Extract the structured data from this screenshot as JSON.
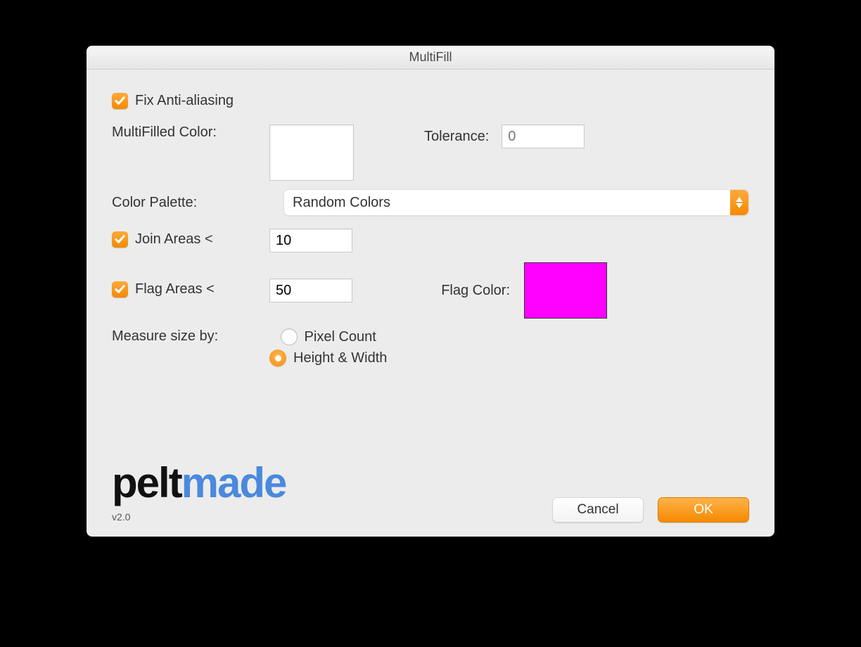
{
  "window": {
    "title": "MultiFill"
  },
  "fixAA": {
    "checked": true,
    "label": "Fix Anti-aliasing"
  },
  "multifilled": {
    "label": "MultiFilled Color:",
    "color": "#ffffff"
  },
  "tolerance": {
    "label": "Tolerance:",
    "value": "",
    "placeholder": "0"
  },
  "palette": {
    "label": "Color Palette:",
    "selected": "Random Colors"
  },
  "joinAreas": {
    "checked": true,
    "label": "Join Areas <",
    "value": "10"
  },
  "flagAreas": {
    "checked": true,
    "label": "Flag Areas <",
    "value": "50"
  },
  "flagColor": {
    "label": "Flag Color:",
    "color": "#ff00ff"
  },
  "measure": {
    "label": "Measure size by:",
    "options": {
      "pixel": "Pixel Count",
      "hw": "Height & Width"
    },
    "selected": "hw"
  },
  "logo": {
    "part1": "pelt",
    "part2": "made"
  },
  "version": "v2.0",
  "buttons": {
    "cancel": "Cancel",
    "ok": "OK"
  }
}
